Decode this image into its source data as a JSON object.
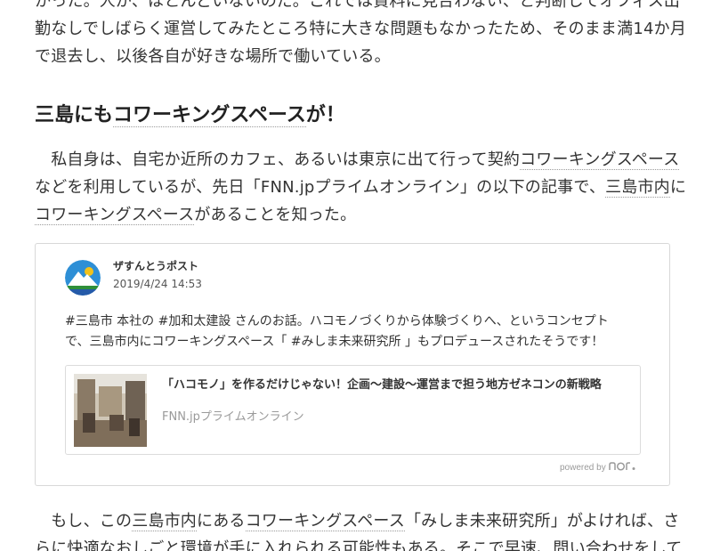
{
  "article": {
    "para1": {
      "line1": "かった。人が、ほとんどいないのだ。これでは賃料に見合わない、と判断してオフィス出",
      "line2": "勤なしでしばらく運営してみたところ特に大きな問題もなかったため、そのまま満14か月",
      "line3": "で退去し、以後各自が好きな場所で働いている。"
    },
    "heading": {
      "pre": "三島にも",
      "link": "コワーキングスペース",
      "post": "が！"
    },
    "para2": {
      "l1_a": "　私自身は、自宅か近所のカフェ、あるいは東京に出て行って契約",
      "l1_link": "コワーキングスペース",
      "l2_a": "などを利用しているが、先日「FNN.jpプライムオンライン」の以下の記事で、",
      "l2_link": "三島市内",
      "l2_b": "に",
      "l3_link": "コワーキングスペース",
      "l3_b": "があることを知った。"
    },
    "para3": {
      "l1_a": "　もし、この",
      "l1_link1": "三島市内",
      "l1_b": "にある",
      "l1_link2": "コワーキングスペース",
      "l1_c": "「みしま未来研究所」がよければ、さ",
      "l2": "らに快適なおしごと環境が手に入れられる可能性もある。そこで早速、問い合わせをして"
    }
  },
  "embed": {
    "author": "ザすんとうポスト",
    "date": "2019/4/24 14:53",
    "text_line1": "#三島市 本社の #加和太建設 さんのお話。ハコモノづくりから体験づくりへ、というコンセプト",
    "text_line2": "で、三島市内にコワーキングスペース「 #みしま未来研究所 」もプロデュースされたそうです！",
    "link_title": "「ハコモノ」を作るだけじゃない！企画〜建設〜運営まで担う地方ゼネコンの新戦略",
    "link_source": "FNN.jpプライムオンライン",
    "powered_by": "powered by",
    "avatar_icon": "mountain-logo-icon",
    "service_logo_icon": "note-logo-icon"
  },
  "colors": {
    "text": "#333333",
    "muted": "#9a9a9a",
    "border": "#d8d8d8"
  }
}
